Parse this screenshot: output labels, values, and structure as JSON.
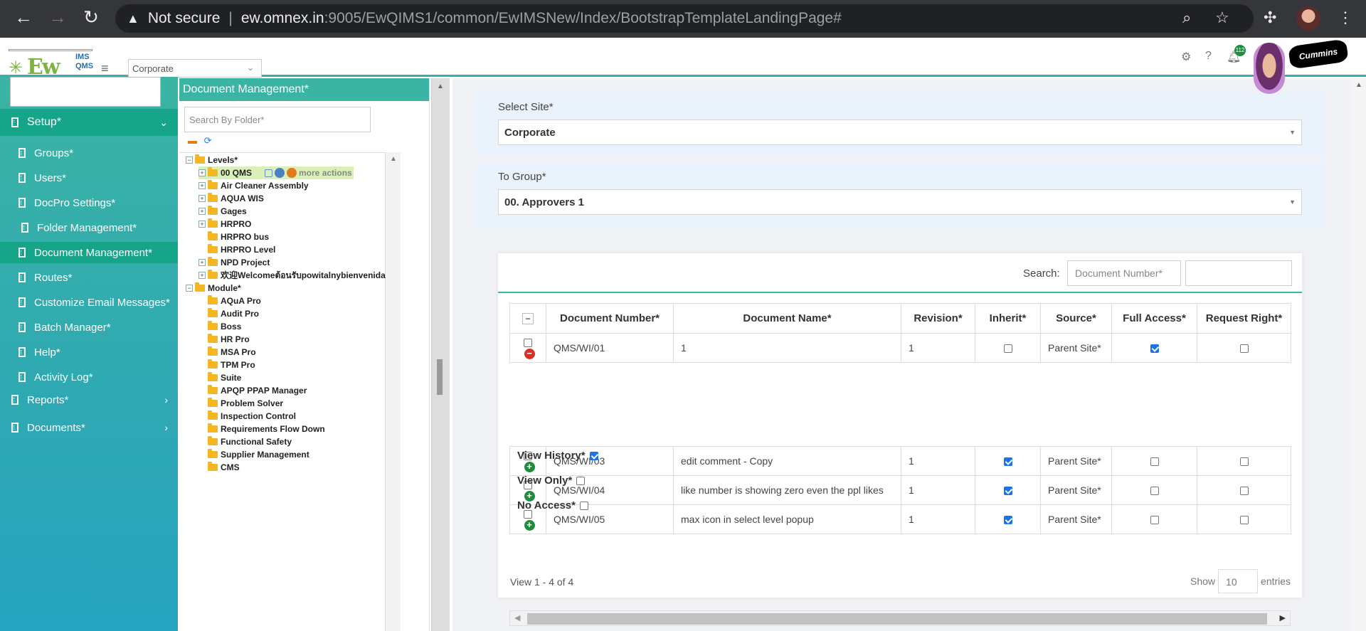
{
  "browser": {
    "security_label": "Not secure",
    "url_host": "ew.omnex.in",
    "url_path": ":9005/EwQIMS1/common/EwIMSNew/Index/BootstrapTemplateLandingPage#"
  },
  "header": {
    "logo_text": "Ew",
    "logo_ims": "IMS",
    "logo_qms": "QMS",
    "site_value": "Corporate",
    "notification_count": "112",
    "brand_text": "Cummins"
  },
  "sidebar": {
    "setup_label": "Setup*",
    "items": [
      {
        "label": "Groups*"
      },
      {
        "label": "Users*"
      },
      {
        "label": "DocPro Settings*"
      },
      {
        "label": "Folder Management*"
      },
      {
        "label": "Document Management*"
      },
      {
        "label": "Routes*"
      },
      {
        "label": "Customize Email Messages*"
      },
      {
        "label": "Batch Manager*"
      },
      {
        "label": "Help*"
      },
      {
        "label": "Activity Log*"
      }
    ],
    "reports_label": "Reports*",
    "documents_label": "Documents*"
  },
  "tree": {
    "title": "Document Management*",
    "search_placeholder": "Search By Folder*",
    "levels_label": "Levels*",
    "module_label": "Module*",
    "more_actions": "more actions",
    "level_nodes": [
      "00 QMS",
      "Air Cleaner Assembly",
      "AQUA WIS",
      "Gages",
      "HRPRO",
      "HRPRO bus",
      "HRPRO Level",
      "NPD Project",
      "欢迎Welcomeต้อนรับpowitalnybienvenida"
    ],
    "module_nodes": [
      "AQuA Pro",
      "Audit Pro",
      "Boss",
      "HR Pro",
      "MSA Pro",
      "TPM Pro",
      "Suite",
      "APQP PPAP Manager",
      "Problem Solver",
      "Inspection Control",
      "Requirements Flow Down",
      "Functional Safety",
      "Supplier Management",
      "CMS"
    ]
  },
  "form": {
    "select_site_label": "Select Site*",
    "select_site_value": "Corporate",
    "to_group_label": "To Group*",
    "to_group_value": "00. Approvers 1"
  },
  "grid": {
    "search_label": "Search:",
    "search_placeholder": "Document Number*",
    "columns": {
      "doc_number": "Document Number*",
      "doc_name": "Document Name*",
      "revision": "Revision*",
      "inherit": "Inherit*",
      "source": "Source*",
      "full_access": "Full Access*",
      "request_right": "Request Right*"
    },
    "rows": [
      {
        "number": "QMS/WI/01",
        "name": "1",
        "revision": "1",
        "source": "Parent Site*"
      },
      {
        "number": "QMS/WI/03",
        "name": "edit comment - Copy",
        "revision": "1",
        "source": "Parent Site*"
      },
      {
        "number": "QMS/WI/04",
        "name": "like number is showing zero even the ppl likes",
        "revision": "1",
        "source": "Parent Site*"
      },
      {
        "number": "QMS/WI/05",
        "name": "max icon in select level popup",
        "revision": "1",
        "source": "Parent Site*"
      }
    ],
    "expanded": {
      "view_history": "View History*",
      "view_only": "View Only*",
      "no_access": "No Access*"
    },
    "pager_text": "View 1 - 4 of 4",
    "show_label": "Show",
    "page_size": "10",
    "entries_label": "entries"
  },
  "colors": {
    "accent": "#3bb4a4",
    "active": "#16a589",
    "checkbox_checked": "#1a73e8"
  }
}
